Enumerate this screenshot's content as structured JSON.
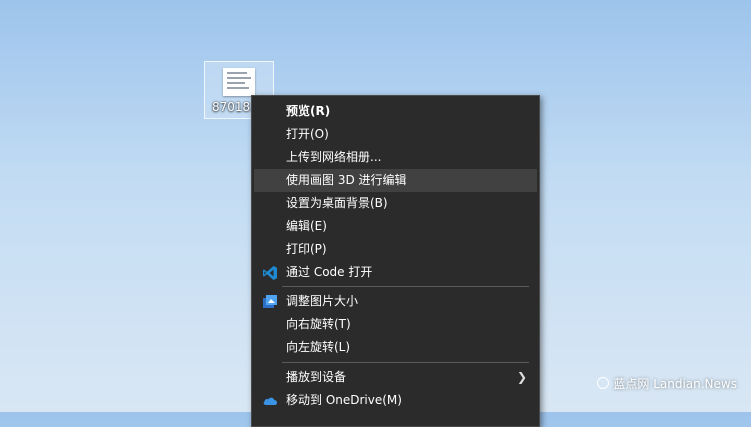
{
  "desktop": {
    "file_label": "87018."
  },
  "menu": {
    "items": [
      {
        "label": "预览(R)"
      },
      {
        "label": "打开(O)"
      },
      {
        "label": "上传到网络相册..."
      },
      {
        "label": "使用画图 3D 进行编辑"
      },
      {
        "label": "设置为桌面背景(B)"
      },
      {
        "label": "编辑(E)"
      },
      {
        "label": "打印(P)"
      },
      {
        "label": "通过 Code 打开",
        "icon": "vscode-icon"
      },
      {
        "label": "调整图片大小",
        "icon": "image-resizer-icon"
      },
      {
        "label": "向右旋转(T)"
      },
      {
        "label": "向左旋转(L)"
      },
      {
        "label": "播放到设备",
        "submenu": true
      },
      {
        "label": "移动到 OneDrive(M)",
        "icon": "onedrive-icon"
      }
    ]
  },
  "watermark": {
    "text": "蓝点网 Landian.News"
  },
  "colors": {
    "menu_bg": "#2b2b2b",
    "menu_hover": "#414141",
    "vscode_blue": "#1f8ad2",
    "onedrive_blue": "#3b93e6"
  }
}
